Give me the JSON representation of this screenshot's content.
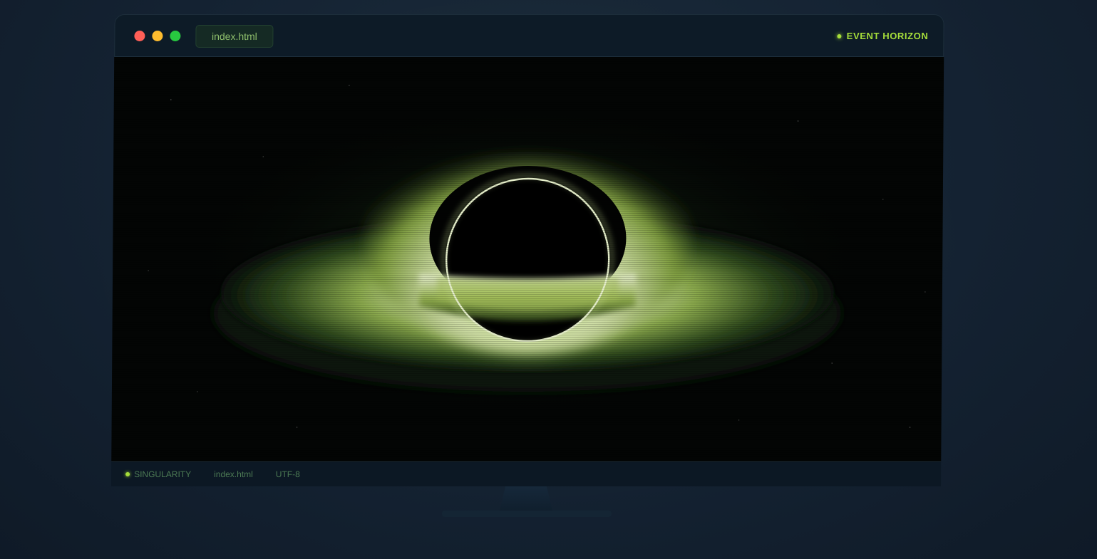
{
  "window": {
    "tab_label": "index.html",
    "title_status": "EVENT HORIZON"
  },
  "statusbar": {
    "mode": "SINGULARITY",
    "file": "index.html",
    "encoding": "UTF-8"
  },
  "colors": {
    "accent": "#a6de3a",
    "disk_glow": "#9bbd4a",
    "background": "#142232",
    "viewport": "#030504"
  },
  "icons": {
    "close": "close-dot-icon",
    "minimize": "minimize-dot-icon",
    "maximize": "maximize-dot-icon",
    "status": "status-led-icon"
  }
}
